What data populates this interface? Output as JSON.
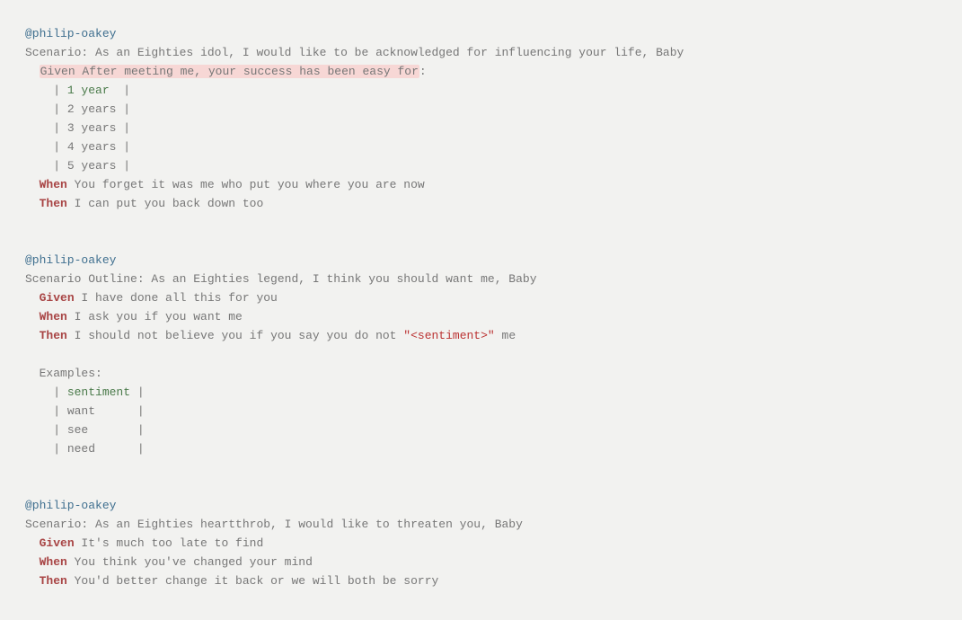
{
  "block1": {
    "tag": "@philip-oakey",
    "scenario_kw": "Scenario:",
    "scenario_text": " As an Eighties idol, I would like to be acknowledged for influencing your life, Baby",
    "given_hl": "Given After meeting me, your success has been easy for",
    "colon": ":",
    "rows": [
      {
        "pre": "    | ",
        "val": "1 year ",
        "post": " |"
      },
      {
        "pre": "    | ",
        "val": "2 years",
        "post": " |"
      },
      {
        "pre": "    | ",
        "val": "3 years",
        "post": " |"
      },
      {
        "pre": "    | ",
        "val": "4 years",
        "post": " |"
      },
      {
        "pre": "    | ",
        "val": "5 years",
        "post": " |"
      }
    ],
    "when_kw": "When",
    "when_text": " You forget it was me who put you where you are now",
    "then_kw": "Then",
    "then_text": " I can put you back down too"
  },
  "block2": {
    "tag": "@philip-oakey",
    "scenario_kw": "Scenario Outline:",
    "scenario_text": " As an Eighties legend, I think you should want me, Baby",
    "given_kw": "Given",
    "given_text": " I have done all this for you",
    "when_kw": "When",
    "when_text": " I ask you if you want me",
    "then_kw": "Then",
    "then_text": " I should not believe you if you say you do not ",
    "then_quoted": "\"<sentiment>\"",
    "then_text2": " me",
    "examples_kw": "Examples:",
    "header": {
      "pre": "    | ",
      "val": "sentiment",
      "post": " |"
    },
    "rows": [
      {
        "pre": "    | ",
        "val": "want     ",
        "post": " |"
      },
      {
        "pre": "    | ",
        "val": "see      ",
        "post": " |"
      },
      {
        "pre": "    | ",
        "val": "need     ",
        "post": " |"
      }
    ]
  },
  "block3": {
    "tag": "@philip-oakey",
    "scenario_kw": "Scenario:",
    "scenario_text": " As an Eighties heartthrob, I would like to threaten you, Baby",
    "given_kw": "Given",
    "given_text": " It's much too late to find",
    "when_kw": "When",
    "when_text": " You think you've changed your mind",
    "then_kw": "Then",
    "then_text": " You'd better change it back or we will both be sorry"
  }
}
